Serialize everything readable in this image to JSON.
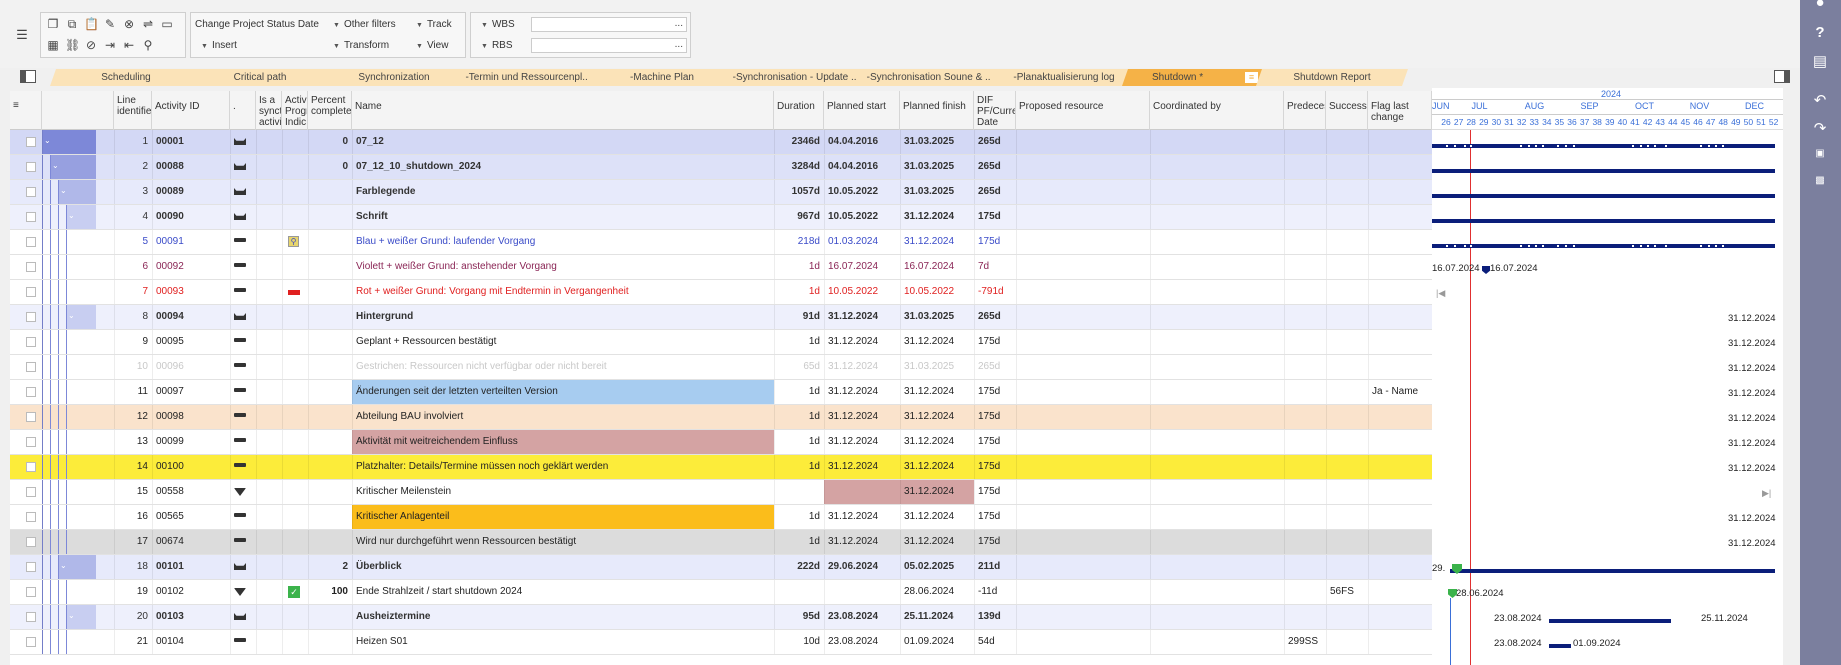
{
  "toolbar": {
    "change_status": "Change Project Status Date",
    "insert": "Insert",
    "other_filters": "Other filters",
    "transform": "Transform",
    "track": "Track",
    "view": "View",
    "wbs": "WBS",
    "rbs": "RBS",
    "wbs_value": "...",
    "rbs_value": "..."
  },
  "tabs": [
    {
      "label": "Scheduling"
    },
    {
      "label": "Critical path"
    },
    {
      "label": "Synchronization"
    },
    {
      "label": "-Termin und Ressourcenpl..."
    },
    {
      "label": "-Machine Plan"
    },
    {
      "label": "-Synchronisation - Update ..."
    },
    {
      "label": "-Synchronisation Soune & ..."
    },
    {
      "label": "-Planaktualisierung log"
    },
    {
      "label": "Shutdown *"
    },
    {
      "label": "Shutdown Report"
    }
  ],
  "columns": {
    "line": "Line identifie",
    "activity_id": "Activity ID",
    "dot": ".",
    "sync": "Is a synct activi",
    "activ": "Activ Progr Indic",
    "percent": "Percent complete",
    "name": "Name",
    "duration": "Duration",
    "planned_start": "Planned start",
    "planned_finish": "Planned finish",
    "dif": "DIF PF/Curre Date",
    "proposed": "Proposed resource",
    "coordinated": "Coordinated by",
    "predecessors": "Predeces",
    "successors": "Successo",
    "flag": "Flag last change"
  },
  "rows": [
    {
      "line": "1",
      "id": "00001",
      "pct": "0",
      "name": "07_12",
      "dur": "2346d",
      "start": "04.04.2016",
      "finish": "31.03.2025",
      "dif": "265d",
      "pred": "",
      "succ": "",
      "flag": ""
    },
    {
      "line": "2",
      "id": "00088",
      "pct": "0",
      "name": "07_12_10_shutdown_2024",
      "dur": "3284d",
      "start": "04.04.2016",
      "finish": "31.03.2025",
      "dif": "265d",
      "pred": "",
      "succ": "",
      "flag": ""
    },
    {
      "line": "3",
      "id": "00089",
      "pct": "",
      "name": "Farblegende",
      "dur": "1057d",
      "start": "10.05.2022",
      "finish": "31.03.2025",
      "dif": "265d",
      "pred": "",
      "succ": "",
      "flag": ""
    },
    {
      "line": "4",
      "id": "00090",
      "pct": "",
      "name": "Schrift",
      "dur": "967d",
      "start": "10.05.2022",
      "finish": "31.12.2024",
      "dif": "175d",
      "pred": "",
      "succ": "",
      "flag": ""
    },
    {
      "line": "5",
      "id": "00091",
      "pct": "",
      "name": "Blau + weißer Grund: laufender Vorgang",
      "dur": "218d",
      "start": "01.03.2024",
      "finish": "31.12.2024",
      "dif": "175d",
      "pred": "",
      "succ": "",
      "flag": ""
    },
    {
      "line": "6",
      "id": "00092",
      "pct": "",
      "name": "Violett + weißer Grund: anstehender Vorgang",
      "dur": "1d",
      "start": "16.07.2024",
      "finish": "16.07.2024",
      "dif": "7d",
      "pred": "",
      "succ": "",
      "flag": ""
    },
    {
      "line": "7",
      "id": "00093",
      "pct": "",
      "name": "Rot + weißer Grund: Vorgang mit Endtermin in Vergangenheit",
      "dur": "1d",
      "start": "10.05.2022",
      "finish": "10.05.2022",
      "dif": "-791d",
      "pred": "",
      "succ": "",
      "flag": ""
    },
    {
      "line": "8",
      "id": "00094",
      "pct": "",
      "name": "Hintergrund",
      "dur": "91d",
      "start": "31.12.2024",
      "finish": "31.03.2025",
      "dif": "265d",
      "pred": "",
      "succ": "",
      "flag": ""
    },
    {
      "line": "9",
      "id": "00095",
      "pct": "",
      "name": "Geplant + Ressourcen bestätigt",
      "dur": "1d",
      "start": "31.12.2024",
      "finish": "31.12.2024",
      "dif": "175d",
      "pred": "",
      "succ": "",
      "flag": ""
    },
    {
      "line": "10",
      "id": "00096",
      "pct": "",
      "name": "Gestrichen: Ressourcen nicht verfügbar oder nicht bereit",
      "dur": "65d",
      "start": "31.12.2024",
      "finish": "31.03.2025",
      "dif": "265d",
      "pred": "",
      "succ": "",
      "flag": ""
    },
    {
      "line": "11",
      "id": "00097",
      "pct": "",
      "name": "Änderungen seit der letzten verteilten Version",
      "dur": "1d",
      "start": "31.12.2024",
      "finish": "31.12.2024",
      "dif": "175d",
      "pred": "",
      "succ": "",
      "flag": "Ja - Name"
    },
    {
      "line": "12",
      "id": "00098",
      "pct": "",
      "name": "Abteilung BAU involviert",
      "dur": "1d",
      "start": "31.12.2024",
      "finish": "31.12.2024",
      "dif": "175d",
      "pred": "",
      "succ": "",
      "flag": ""
    },
    {
      "line": "13",
      "id": "00099",
      "pct": "",
      "name": "Aktivität mit weitreichendem Einfluss",
      "dur": "1d",
      "start": "31.12.2024",
      "finish": "31.12.2024",
      "dif": "175d",
      "pred": "",
      "succ": "",
      "flag": ""
    },
    {
      "line": "14",
      "id": "00100",
      "pct": "",
      "name": "Platzhalter: Details/Termine müssen noch geklärt werden",
      "dur": "1d",
      "start": "31.12.2024",
      "finish": "31.12.2024",
      "dif": "175d",
      "pred": "",
      "succ": "",
      "flag": ""
    },
    {
      "line": "15",
      "id": "00558",
      "pct": "",
      "name": "Kritischer Meilenstein",
      "dur": "",
      "start": "",
      "finish": "31.12.2024",
      "dif": "175d",
      "pred": "",
      "succ": "",
      "flag": ""
    },
    {
      "line": "16",
      "id": "00565",
      "pct": "",
      "name": "Kritischer Anlagenteil",
      "dur": "1d",
      "start": "31.12.2024",
      "finish": "31.12.2024",
      "dif": "175d",
      "pred": "",
      "succ": "",
      "flag": ""
    },
    {
      "line": "17",
      "id": "00674",
      "pct": "",
      "name": "Wird nur durchgeführt wenn Ressourcen bestätigt",
      "dur": "1d",
      "start": "31.12.2024",
      "finish": "31.12.2024",
      "dif": "175d",
      "pred": "",
      "succ": "",
      "flag": ""
    },
    {
      "line": "18",
      "id": "00101",
      "pct": "2",
      "name": "Überblick",
      "dur": "222d",
      "start": "29.06.2024",
      "finish": "05.02.2025",
      "dif": "211d",
      "pred": "",
      "succ": "",
      "flag": ""
    },
    {
      "line": "19",
      "id": "00102",
      "pct": "100",
      "name": "Ende Strahlzeit / start shutdown 2024",
      "dur": "",
      "start": "",
      "finish": "28.06.2024",
      "dif": "-11d",
      "pred": "",
      "succ": "56FS",
      "flag": ""
    },
    {
      "line": "20",
      "id": "00103",
      "pct": "",
      "name": "Ausheiztermine",
      "dur": "95d",
      "start": "23.08.2024",
      "finish": "25.11.2024",
      "dif": "139d",
      "pred": "",
      "succ": "",
      "flag": ""
    },
    {
      "line": "21",
      "id": "00104",
      "pct": "",
      "name": "Heizen S01",
      "dur": "10d",
      "start": "23.08.2024",
      "finish": "01.09.2024",
      "dif": "54d",
      "pred": "299SS",
      "succ": "",
      "flag": ""
    }
  ],
  "gantt": {
    "year": "2024",
    "months": [
      "JUN",
      "JUL",
      "AUG",
      "SEP",
      "OCT",
      "NOV",
      "DEC"
    ],
    "weeks": [
      "26",
      "27",
      "28",
      "29",
      "30",
      "31",
      "32",
      "33",
      "34",
      "35",
      "36",
      "37",
      "38",
      "39",
      "40",
      "41",
      "42",
      "43",
      "44",
      "45",
      "46",
      "47",
      "48",
      "49",
      "50",
      "51",
      "52"
    ],
    "labels": {
      "r6a": "16.07.2024",
      "r6b": "16.07.2024",
      "r8": "31.12.2024",
      "r9": "31.12.2024",
      "r10": "31.12.2024",
      "r11": "31.12.2024",
      "r12": "31.12.2024",
      "r13": "31.12.2024",
      "r14": "31.12.2024",
      "r16": "31.12.2024",
      "r17": "31.12.2024",
      "r18": "29.",
      "r19": "28.06.2024",
      "r20a": "23.08.2024",
      "r20b": "25.11.2024",
      "r21a": "23.08.2024",
      "r21b": "01.09.2024"
    }
  },
  "colors": {
    "accent": "#f5b247",
    "summary_bar": "#0b1e7a",
    "today_line": "#e03030",
    "sidebar": "#7b7f9e"
  }
}
